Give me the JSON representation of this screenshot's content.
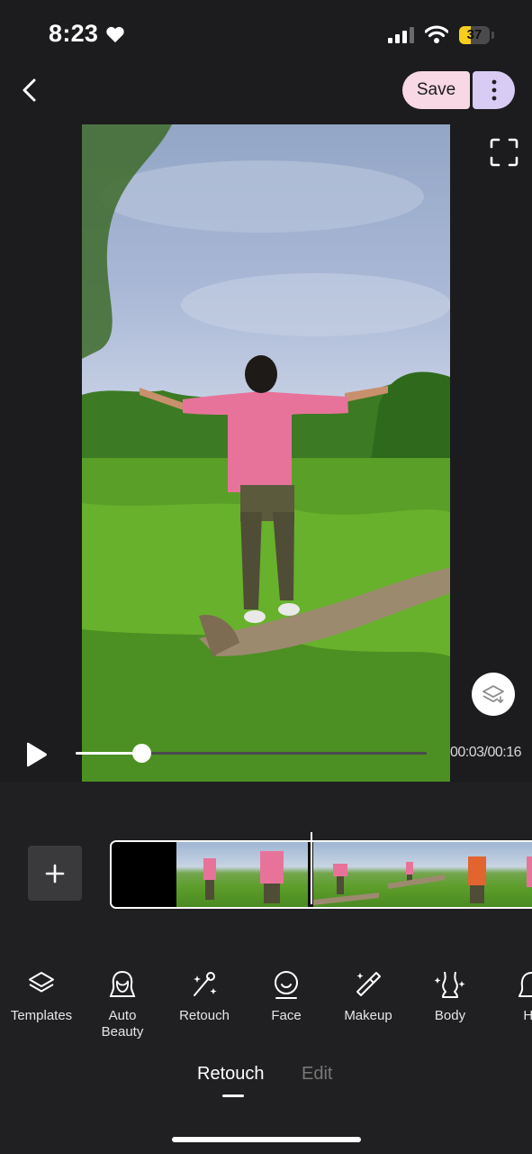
{
  "status_bar": {
    "time": "8:23",
    "battery_percent": "37",
    "battery_level": 0.37,
    "battery_color": "#f7ce1d"
  },
  "header": {
    "save_label": "Save",
    "save_bg": "#f8d8e4",
    "more_bg": "#d8cbf4"
  },
  "player": {
    "time_readout": "00:03/00:16",
    "progress": 0.1875
  },
  "tools": [
    {
      "label": "Templates",
      "icon": "layers-icon"
    },
    {
      "label": "Auto\nBeauty",
      "icon": "face-outline-icon"
    },
    {
      "label": "Retouch",
      "icon": "magic-wand-icon"
    },
    {
      "label": "Face",
      "icon": "face-icon"
    },
    {
      "label": "Makeup",
      "icon": "lipstick-icon"
    },
    {
      "label": "Body",
      "icon": "body-icon"
    },
    {
      "label": "Ha",
      "icon": "hair-icon"
    }
  ],
  "tabs": {
    "active": "Retouch",
    "inactive": "Edit"
  }
}
